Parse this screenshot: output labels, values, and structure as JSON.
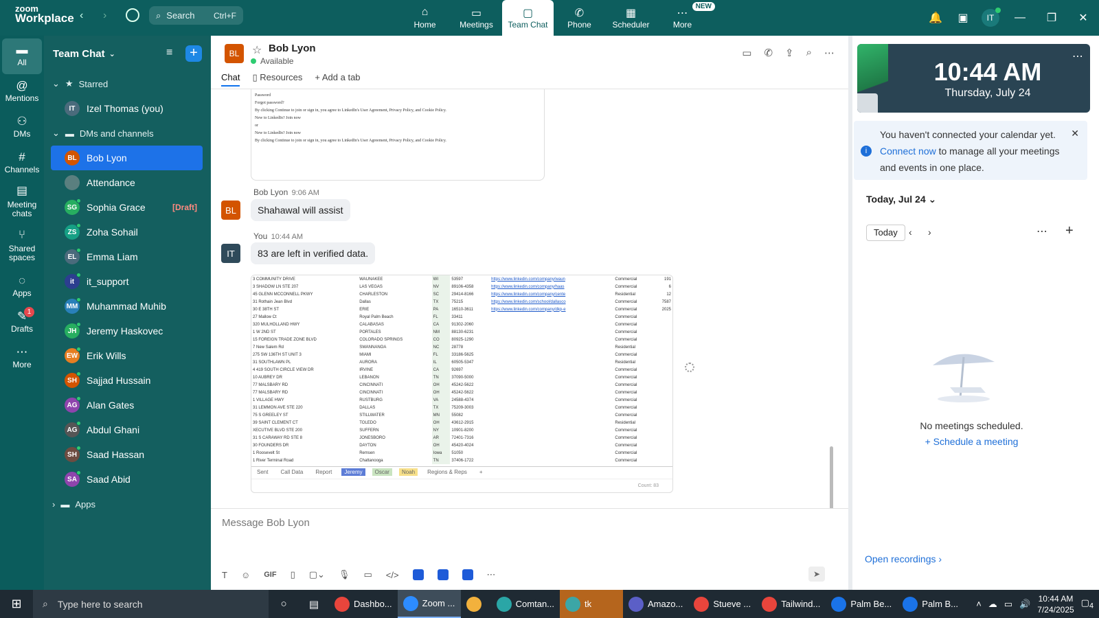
{
  "app": {
    "brand_line1": "zoom",
    "brand_line2": "Workplace"
  },
  "search": {
    "label": "Search",
    "shortcut": "Ctrl+F"
  },
  "top_tabs": [
    {
      "label": "Home",
      "icon": "home-icon"
    },
    {
      "label": "Meetings",
      "icon": "video-icon"
    },
    {
      "label": "Team Chat",
      "icon": "chat-icon"
    },
    {
      "label": "Phone",
      "icon": "phone-icon"
    },
    {
      "label": "Scheduler",
      "icon": "calendar-icon"
    },
    {
      "label": "More",
      "icon": "more-icon",
      "badge": "NEW"
    }
  ],
  "user_initials": "IT",
  "rail": [
    {
      "label": "All"
    },
    {
      "label": "Mentions"
    },
    {
      "label": "DMs"
    },
    {
      "label": "Channels"
    },
    {
      "label": "Meeting chats"
    },
    {
      "label": "Shared spaces"
    },
    {
      "label": "Apps"
    },
    {
      "label": "Drafts",
      "badge": "1"
    },
    {
      "label": "More"
    }
  ],
  "sidebar": {
    "title": "Team Chat",
    "starred_label": "Starred",
    "starred": [
      {
        "initials": "IT",
        "name": "Izel Thomas (you)",
        "color": "#4a6b7c"
      }
    ],
    "dms_label": "DMs and channels",
    "items": [
      {
        "initials": "BL",
        "name": "Bob Lyon",
        "color": "#d35400"
      },
      {
        "initials": "",
        "name": "Attendance",
        "color": "#5a7f7f"
      },
      {
        "initials": "SG",
        "name": "Sophia Grace",
        "color": "#27ae60",
        "draft": "[Draft]"
      },
      {
        "initials": "ZS",
        "name": "Zoha Sohail",
        "color": "#16a085"
      },
      {
        "initials": "EL",
        "name": "Emma Liam",
        "color": "#4a6b7c"
      },
      {
        "initials": "it",
        "name": "it_support",
        "color": "#2c3e8f"
      },
      {
        "initials": "MM",
        "name": "Muhammad Muhib",
        "color": "#2980b9"
      },
      {
        "initials": "JH",
        "name": "Jeremy Haskovec",
        "color": "#27ae60"
      },
      {
        "initials": "EW",
        "name": "Erik Wills",
        "color": "#e67e22"
      },
      {
        "initials": "SH",
        "name": "Sajjad Hussain",
        "color": "#d35400"
      },
      {
        "initials": "AG",
        "name": "Alan Gates",
        "color": "#8e44ad"
      },
      {
        "initials": "AG",
        "name": "Abdul Ghani",
        "color": "#555555"
      },
      {
        "initials": "SH",
        "name": "Saad Hassan",
        "color": "#6d4c41"
      },
      {
        "initials": "SA",
        "name": "Saad Abid",
        "color": "#8e44ad"
      }
    ],
    "apps_label": "Apps"
  },
  "chat": {
    "name": "Bob Lyon",
    "initials": "BL",
    "status": "Available",
    "tabs": [
      "Chat",
      "Resources",
      "Add a tab"
    ],
    "snippet_lines": [
      "Password",
      "Forgot password?",
      "By clicking Continue to join or sign in, you agree to LinkedIn's User Agreement, Privacy Policy, and Cookie Policy.",
      "New to LinkedIn? Join now",
      "or",
      "New to LinkedIn? Join now",
      "By clicking Continue to join or sign in, you agree to LinkedIn's User Agreement, Privacy Policy, and Cookie Policy."
    ],
    "messages": [
      {
        "sender": "Bob Lyon",
        "time": "9:06 AM",
        "text": "Shahawal will assist",
        "initials": "BL"
      },
      {
        "sender": "You",
        "time": "10:44 AM",
        "text": "83 are left in verified data.",
        "initials": "IT"
      }
    ],
    "sheet_rows": [
      [
        "3 COMMUNITY DRIVE",
        "WAUNAKEE",
        "WI",
        "53597",
        "https://www.linkedin.com/company/waun",
        "Commercial",
        "191"
      ],
      [
        "3 SHADOW LN STE 207",
        "LAS VEGAS",
        "NV",
        "89106-4358",
        "https://www.linkedin.com/company/haas",
        "Commercial",
        "6"
      ],
      [
        "45 GLENN MCCONNELL PKWY",
        "CHARLESTON",
        "SC",
        "29414-8166",
        "https://www.linkedin.com/company/cente",
        "Residential",
        "12"
      ],
      [
        "31 Rothain Jean Blvd",
        "Dallas",
        "TX",
        "75215",
        "https://www.linkedin.com/school/dallasco",
        "Commercial",
        "7587"
      ],
      [
        "30 E 38TH ST",
        "ERIE",
        "PA",
        "16510-3611",
        "https://www.linkedin.com/company/dkp-e",
        "Commercial",
        "2025"
      ],
      [
        "27 Mallow Ct",
        "Royal Palm Beach",
        "FL",
        "33411",
        "",
        "Commercial",
        ""
      ],
      [
        "320 MULHOLLAND HWY",
        "CALABASAS",
        "CA",
        "91302-2060",
        "",
        "Commercial",
        ""
      ],
      [
        "1 W 2ND ST",
        "PORTALES",
        "NM",
        "88130-6231",
        "",
        "Commercial",
        ""
      ],
      [
        "15 FOREIGN TRADE ZONE BLVD",
        "COLORADO SPRINGS",
        "CO",
        "80925-1290",
        "",
        "Commercial",
        ""
      ],
      [
        "7 New Salem Rd",
        "SWANNANOA",
        "NC",
        "28778",
        "",
        "Residential",
        ""
      ],
      [
        "275 SW 136TH ST UNIT 3",
        "MIAMI",
        "FL",
        "33186-5625",
        "",
        "Commercial",
        ""
      ],
      [
        "31 SOUTHLAWN PL",
        "AURORA",
        "IL",
        "60505-5347",
        "",
        "Residential",
        ""
      ],
      [
        "4 419 SOUTH CIRCLE VIEW DR",
        "IRVINE",
        "CA",
        "92697",
        "",
        "Commercial",
        ""
      ],
      [
        "10 AUBREY DR",
        "LEBANON",
        "TN",
        "37090-5000",
        "",
        "Commercial",
        ""
      ],
      [
        "77 MALSBARY RD",
        "CINCINNATI",
        "OH",
        "45242-5622",
        "",
        "Commercial",
        ""
      ],
      [
        "77 MALSBARY RD",
        "CINCINNATI",
        "OH",
        "45242-5622",
        "",
        "Commercial",
        ""
      ],
      [
        "1 VILLAGE HWY",
        "RUSTBURG",
        "VA",
        "24588-4374",
        "",
        "Commercial",
        ""
      ],
      [
        "31 LEMMON AVE STE 220",
        "DALLAS",
        "TX",
        "75209-3003",
        "",
        "Commercial",
        ""
      ],
      [
        "75 S GREELEY ST",
        "STILLWATER",
        "MN",
        "55082",
        "",
        "Commercial",
        ""
      ],
      [
        "39 SAINT CLEMENT CT",
        "TOLEDO",
        "OH",
        "43612-2915",
        "",
        "Residential",
        ""
      ],
      [
        "XECUTIVE BLVD STE 200",
        "SUFFERN",
        "NY",
        "10901-8200",
        "",
        "Commercial",
        ""
      ],
      [
        "31 S CARAWAY RD STE 8",
        "JONESBORO",
        "AR",
        "72401-7316",
        "",
        "Commercial",
        ""
      ],
      [
        "30 FOUNDERS DR",
        "DAYTON",
        "OH",
        "45420-4024",
        "",
        "Commercial",
        ""
      ],
      [
        "1 Roosevelt St",
        "Remsen",
        "Iowa",
        "51050",
        "",
        "Commercial",
        ""
      ],
      [
        "1 River Terminal Road",
        "Chattanooga",
        "TN",
        "37406-1722",
        "",
        "Commercial",
        ""
      ]
    ],
    "sheet_tabs": [
      "Sent",
      "Call Data",
      "Report",
      "Jeremy",
      "Oscar",
      "Noah",
      "Regions & Reps",
      "+"
    ],
    "sheet_footer": "Count: 83",
    "composer_placeholder": "Message Bob Lyon"
  },
  "right_panel": {
    "time": "10:44 AM",
    "date": "Thursday, July 24",
    "banner_text_1": "You haven't connected your calendar yet.",
    "banner_link": "Connect now",
    "banner_text_2": "to manage all your meetings and events in one place.",
    "today_label": "Today, Jul 24",
    "today_btn": "Today",
    "no_meetings": "No meetings scheduled.",
    "schedule_link": "Schedule a meeting",
    "open_recordings": "Open recordings"
  },
  "taskbar": {
    "search_placeholder": "Type here to search",
    "apps": [
      {
        "label": "Dashbo...",
        "color": "#e8453c"
      },
      {
        "label": "Zoom ...",
        "color": "#2d8cff"
      },
      {
        "label": "",
        "color": "#f2b13d"
      },
      {
        "label": "Comtan...",
        "color": "#2aa6a6"
      },
      {
        "label": "tk",
        "color": "#3ca6a6"
      },
      {
        "label": "Amazo...",
        "color": "#5b5fc7"
      },
      {
        "label": "Stueve ...",
        "color": "#e8453c"
      },
      {
        "label": "Tailwind...",
        "color": "#e8453c"
      },
      {
        "label": "Palm Be...",
        "color": "#1a73e8"
      },
      {
        "label": "Palm B...",
        "color": "#1a73e8"
      }
    ],
    "time": "10:44 AM",
    "date": "7/24/2025",
    "notif_count": "4"
  }
}
